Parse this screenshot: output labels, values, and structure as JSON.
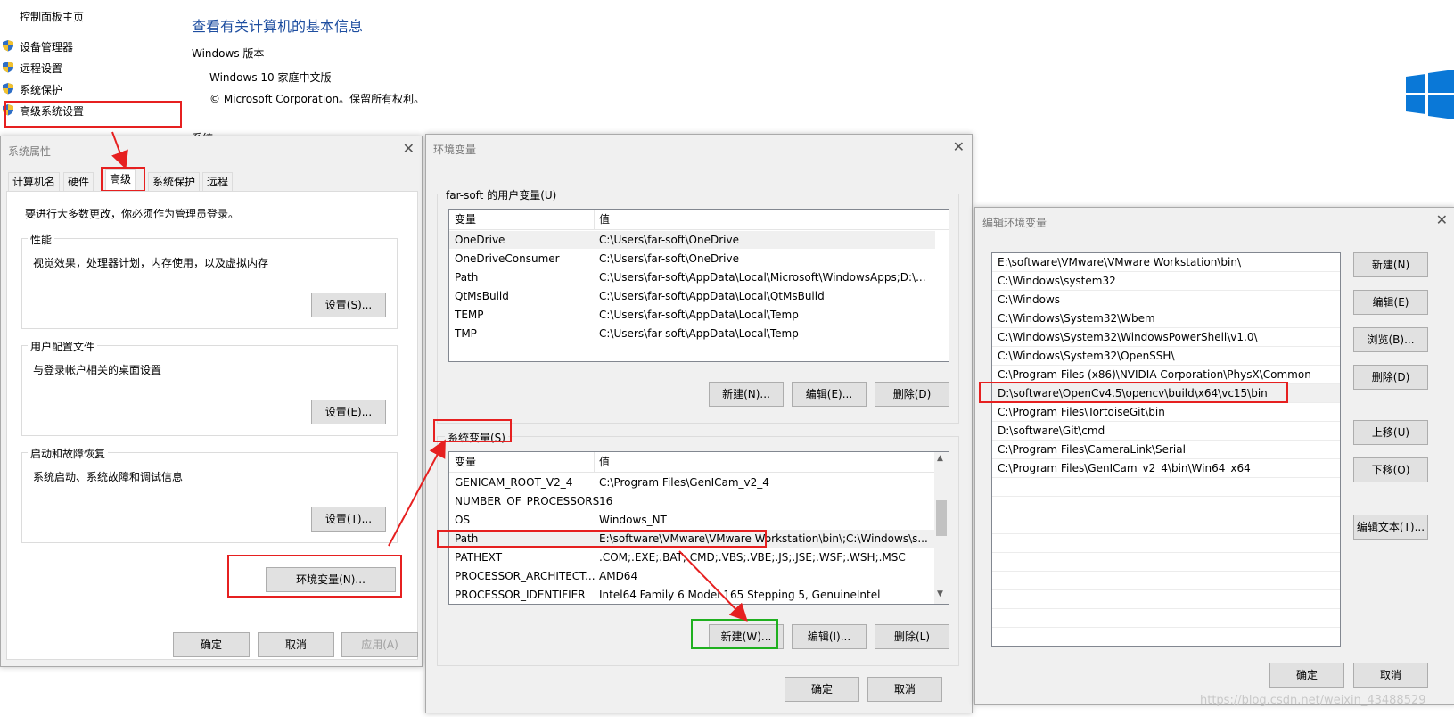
{
  "control_panel": {
    "home_link": "控制面板主页",
    "links": [
      "设备管理器",
      "远程设置",
      "系统保护",
      "高级系统设置"
    ],
    "title": "查看有关计算机的基本信息",
    "section_windows": "Windows 版本",
    "edition": "Windows 10 家庭中文版",
    "copyright": "© Microsoft Corporation。保留所有权利。",
    "system_label": "系统"
  },
  "sys_props": {
    "title": "系统属性",
    "tabs": [
      "计算机名",
      "硬件",
      "高级",
      "系统保护",
      "远程"
    ],
    "admin_note": "要进行大多数更改，你必须作为管理员登录。",
    "perf": {
      "label": "性能",
      "desc": "视觉效果，处理器计划，内存使用，以及虚拟内存",
      "button": "设置(S)..."
    },
    "profile": {
      "label": "用户配置文件",
      "desc": "与登录帐户相关的桌面设置",
      "button": "设置(E)..."
    },
    "startup": {
      "label": "启动和故障恢复",
      "desc": "系统启动、系统故障和调试信息",
      "button": "设置(T)..."
    },
    "env_button": "环境变量(N)...",
    "ok": "确定",
    "cancel": "取消",
    "apply": "应用(A)"
  },
  "env_vars": {
    "title": "环境变量",
    "user_group": "far-soft 的用户变量(U)",
    "col_var": "变量",
    "col_val": "值",
    "user_rows": [
      [
        "OneDrive",
        "C:\\Users\\far-soft\\OneDrive"
      ],
      [
        "OneDriveConsumer",
        "C:\\Users\\far-soft\\OneDrive"
      ],
      [
        "Path",
        "C:\\Users\\far-soft\\AppData\\Local\\Microsoft\\WindowsApps;D:\\..."
      ],
      [
        "QtMsBuild",
        "C:\\Users\\far-soft\\AppData\\Local\\QtMsBuild"
      ],
      [
        "TEMP",
        "C:\\Users\\far-soft\\AppData\\Local\\Temp"
      ],
      [
        "TMP",
        "C:\\Users\\far-soft\\AppData\\Local\\Temp"
      ]
    ],
    "user_new": "新建(N)...",
    "user_edit": "编辑(E)...",
    "user_delete": "删除(D)",
    "sys_group": "系统变量(S)",
    "sys_rows": [
      [
        "GENICAM_ROOT_V2_4",
        "C:\\Program Files\\GenICam_v2_4"
      ],
      [
        "NUMBER_OF_PROCESSORS",
        "16"
      ],
      [
        "OS",
        "Windows_NT"
      ],
      [
        "Path",
        "E:\\software\\VMware\\VMware Workstation\\bin\\;C:\\Windows\\s..."
      ],
      [
        "PATHEXT",
        ".COM;.EXE;.BAT;.CMD;.VBS;.VBE;.JS;.JSE;.WSF;.WSH;.MSC"
      ],
      [
        "PROCESSOR_ARCHITECT...",
        "AMD64"
      ],
      [
        "PROCESSOR_IDENTIFIER",
        "Intel64 Family 6 Model 165 Stepping 5, GenuineIntel"
      ]
    ],
    "sys_new": "新建(W)...",
    "sys_edit": "编辑(I)...",
    "sys_delete": "删除(L)",
    "ok": "确定",
    "cancel": "取消"
  },
  "edit_env": {
    "title": "编辑环境变量",
    "entries": [
      "E:\\software\\VMware\\VMware Workstation\\bin\\",
      "C:\\Windows\\system32",
      "C:\\Windows",
      "C:\\Windows\\System32\\Wbem",
      "C:\\Windows\\System32\\WindowsPowerShell\\v1.0\\",
      "C:\\Windows\\System32\\OpenSSH\\",
      "C:\\Program Files (x86)\\NVIDIA Corporation\\PhysX\\Common",
      "D:\\software\\OpenCv4.5\\opencv\\build\\x64\\vc15\\bin",
      "C:\\Program Files\\TortoiseGit\\bin",
      "D:\\software\\Git\\cmd",
      "C:\\Program Files\\CameraLink\\Serial",
      "C:\\Program Files\\GenICam_v2_4\\bin\\Win64_x64"
    ],
    "buttons": [
      "新建(N)",
      "编辑(E)",
      "浏览(B)...",
      "删除(D)",
      "上移(U)",
      "下移(O)",
      "编辑文本(T)..."
    ],
    "ok": "确定",
    "cancel": "取消"
  },
  "watermark": "https://blog.csdn.net/weixin_43488529",
  "colors": {
    "annotation_red": "#e62020",
    "annotation_green": "#1fb01f",
    "link_blue": "#1e4ea0",
    "windows_logo": "#0a78d7"
  }
}
